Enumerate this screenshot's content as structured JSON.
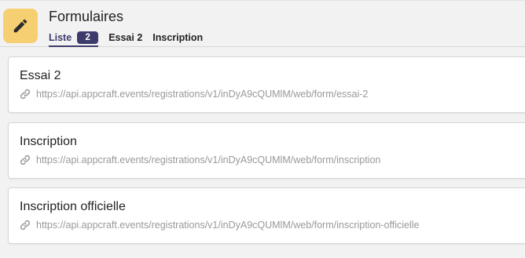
{
  "header": {
    "title": "Formulaires",
    "icon": "pencil-icon",
    "icon_bg": "#f6cf72",
    "tabs": [
      {
        "label": "Liste",
        "badge": "2",
        "active": true
      },
      {
        "label": "Essai 2",
        "active": false
      },
      {
        "label": "Inscription",
        "active": false
      }
    ]
  },
  "forms": [
    {
      "title": "Essai 2",
      "url": "https://api.appcraft.events/registrations/v1/inDyA9cQUMlM/web/form/essai-2"
    },
    {
      "title": "Inscription",
      "url": "https://api.appcraft.events/registrations/v1/inDyA9cQUMlM/web/form/inscription"
    },
    {
      "title": "Inscription officielle",
      "url": "https://api.appcraft.events/registrations/v1/inDyA9cQUMlM/web/form/inscription-officielle"
    }
  ],
  "colors": {
    "accent": "#3d3b6b",
    "link_text": "#999999"
  }
}
